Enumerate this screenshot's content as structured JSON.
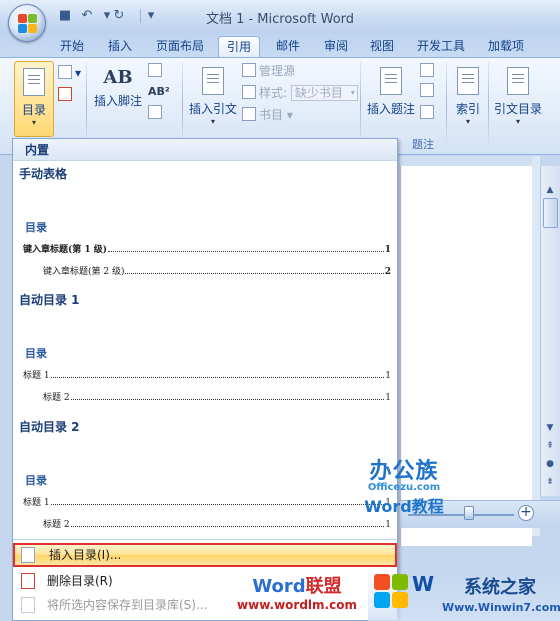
{
  "window": {
    "title": "文档 1 - Microsoft Word"
  },
  "quick_access": {
    "save_icon": "save-icon",
    "undo_icon": "undo-icon",
    "redo_icon": "redo-icon",
    "customize": "▾"
  },
  "tabs": [
    {
      "label": "开始"
    },
    {
      "label": "插入"
    },
    {
      "label": "页面布局"
    },
    {
      "label": "引用",
      "active": true
    },
    {
      "label": "邮件"
    },
    {
      "label": "审阅"
    },
    {
      "label": "视图"
    },
    {
      "label": "开发工具"
    },
    {
      "label": "加载项"
    }
  ],
  "ribbon": {
    "toc_button": "目录",
    "footnote_button": "插入脚注",
    "footnote_group_label": "AB",
    "citation_button": "插入引文",
    "manage_sources": "管理源",
    "style_label": "样式:",
    "style_value": "缺少书目",
    "bibliography": "书目",
    "caption_button": "插入题注",
    "caption_group_label": "题注",
    "index_button": "索引",
    "toa_button": "引文目录"
  },
  "dropdown": {
    "header": "内置",
    "sections": [
      {
        "title": "手动表格",
        "heading": "目录",
        "lines": [
          {
            "text": "键入章标题(第 1 级)",
            "page": "1",
            "level": 1
          },
          {
            "text": "键入章标题(第 2 级)",
            "page": "2",
            "level": 2
          }
        ]
      },
      {
        "title": "自动目录 1",
        "heading": "目录",
        "lines": [
          {
            "text": "标题 1",
            "page": "1",
            "level": 1
          },
          {
            "text": "标题 2",
            "page": "1",
            "level": 2
          }
        ]
      },
      {
        "title": "自动目录 2",
        "heading": "目录",
        "lines": [
          {
            "text": "标题 1",
            "page": "1",
            "level": 1
          },
          {
            "text": "标题 2",
            "page": "1",
            "level": 2
          }
        ]
      }
    ],
    "menu": {
      "insert_toc": "插入目录(I)...",
      "remove_toc": "删除目录(R)",
      "save_to_gallery": "将所选内容保存到目录库(S)..."
    }
  },
  "watermarks": {
    "officezu_big": "办公族",
    "officezu_url": "Officezu.com",
    "word_tutorial": "Word教程",
    "wordlm_title_word": "Word",
    "wordlm_title_cn": "联盟",
    "wordlm_url": "www.wordlm.com",
    "win7_w": "W",
    "win7_cn": "系统之家",
    "win7_url": "Www.Winwin7.com"
  }
}
